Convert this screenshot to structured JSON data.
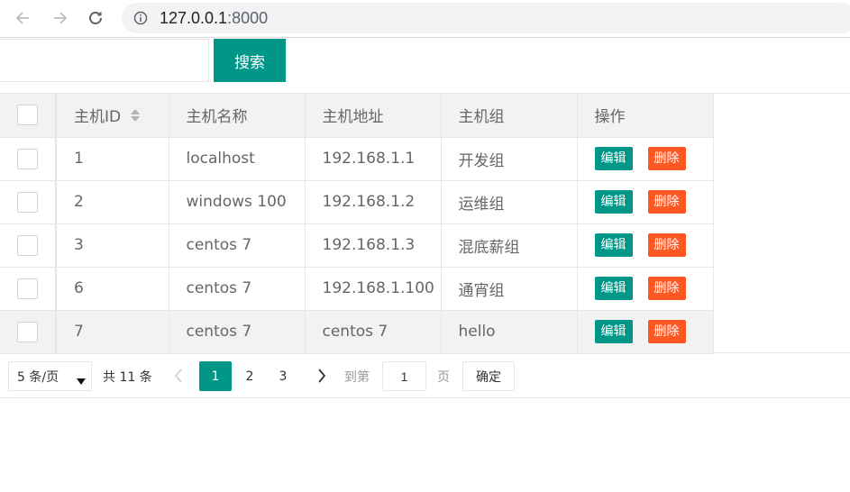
{
  "browser": {
    "url_host": "127.0.0.1",
    "url_port": ":8000"
  },
  "search": {
    "placeholder": "",
    "value": "",
    "button_label": "搜索"
  },
  "table": {
    "columns": [
      "主机ID",
      "主机名称",
      "主机地址",
      "主机组",
      "操作"
    ],
    "rows": [
      {
        "id": "1",
        "name": "localhost",
        "address": "192.168.1.1",
        "group": "开发组"
      },
      {
        "id": "2",
        "name": "windows 100",
        "address": "192.168.1.2",
        "group": "运维组"
      },
      {
        "id": "3",
        "name": "centos 7",
        "address": "192.168.1.3",
        "group": "混底薪组"
      },
      {
        "id": "6",
        "name": "centos 7",
        "address": "192.168.1.100",
        "group": "通宵组"
      },
      {
        "id": "7",
        "name": "centos 7",
        "address": "centos 7",
        "group": "hello"
      }
    ],
    "edit_label": "编辑",
    "delete_label": "删除"
  },
  "pagination": {
    "limit": "5 条/页",
    "total": "共 11 条",
    "pages": [
      "1",
      "2",
      "3"
    ],
    "current_page": "1",
    "goto_label": "到第",
    "goto_value": "1",
    "unit_label": "页",
    "confirm_label": "确定"
  },
  "colors": {
    "primary": "#009688",
    "danger": "#ff5722"
  }
}
